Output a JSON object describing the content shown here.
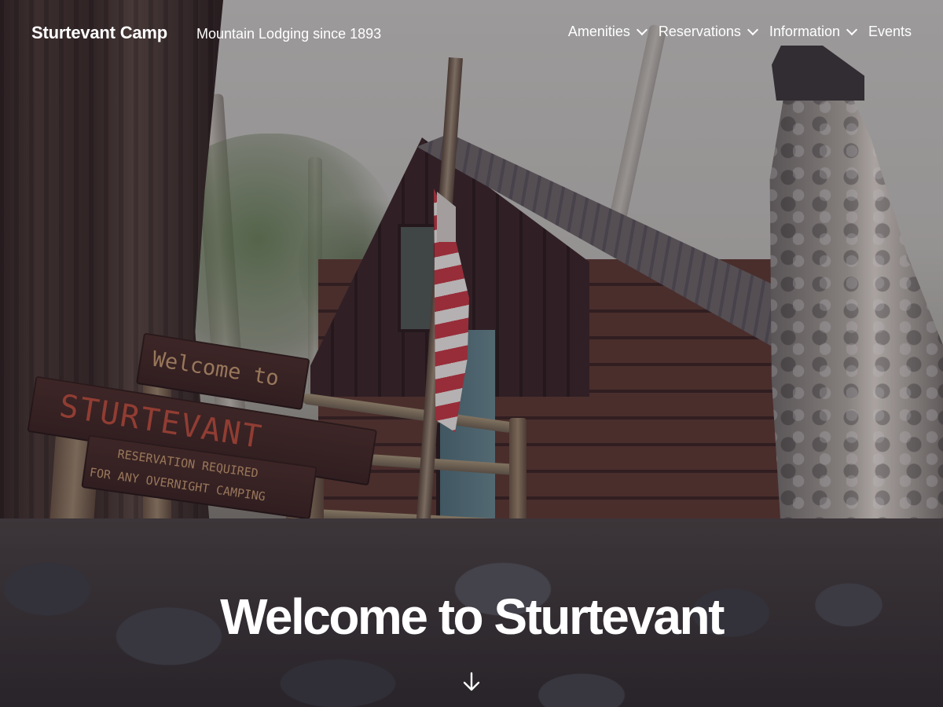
{
  "header": {
    "site_title": "Sturtevant Camp",
    "tagline": "Mountain Lodging since 1893"
  },
  "nav": {
    "items": [
      {
        "label": "Amenities",
        "icon": "chevron-down-icon"
      },
      {
        "label": "Reservations",
        "icon": "chevron-down-icon"
      },
      {
        "label": "Information",
        "icon": "chevron-down-icon"
      },
      {
        "label": "Events"
      }
    ]
  },
  "hero": {
    "title": "Welcome to Sturtevant",
    "scroll_icon": "arrow-down-icon",
    "sign": {
      "line1": "Welcome to",
      "line2": "STURTEVANT",
      "line3": "RESERVATION REQUIRED",
      "line4": "FOR ANY OVERNIGHT CAMPING"
    }
  },
  "colors": {
    "text": "#ffffff",
    "sign_board": "#3a241f",
    "sign_lettering": "#c0503a",
    "sign_lettering_small": "#c9a070"
  }
}
